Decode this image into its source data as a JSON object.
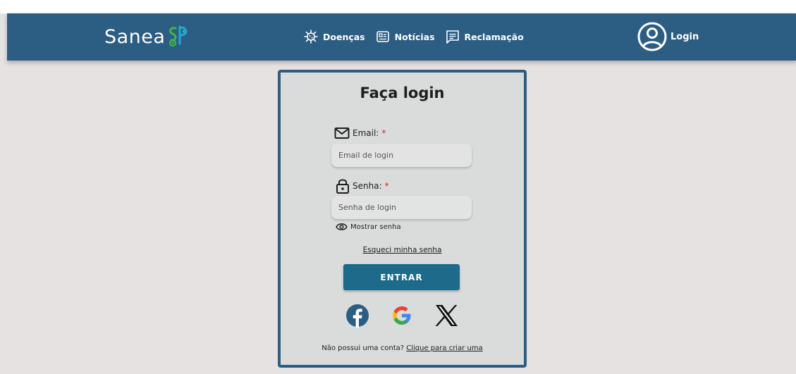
{
  "header": {
    "logo_text": "Sanea",
    "logo_suffix": "SP",
    "nav": [
      {
        "label": "Doenças",
        "icon": "virus-icon"
      },
      {
        "label": "Notícias",
        "icon": "news-icon"
      },
      {
        "label": "Reclamação",
        "icon": "complaint-icon"
      }
    ],
    "login_label": "Login"
  },
  "login_form": {
    "title": "Faça login",
    "email_label": "Email:",
    "email_placeholder": "Email de login",
    "email_value": "",
    "password_label": "Senha:",
    "password_placeholder": "Senha de login",
    "password_value": "",
    "required_mark": "*",
    "show_password_label": "Mostrar senha",
    "forgot_password": "Esqueci minha senha",
    "submit_label": "ENTRAR",
    "social": [
      "facebook-icon",
      "google-icon",
      "x-icon"
    ],
    "no_account_text": "Não possui uma conta?",
    "signup_link": "Clique para criar uma"
  },
  "colors": {
    "navbar": "#2c5d82",
    "background": "#e6e2e1",
    "card": "#dadbdb",
    "button": "#1d6a8b",
    "logo_green": "#3fb44a",
    "logo_blue": "#1ea5d8",
    "required": "#e02020"
  }
}
